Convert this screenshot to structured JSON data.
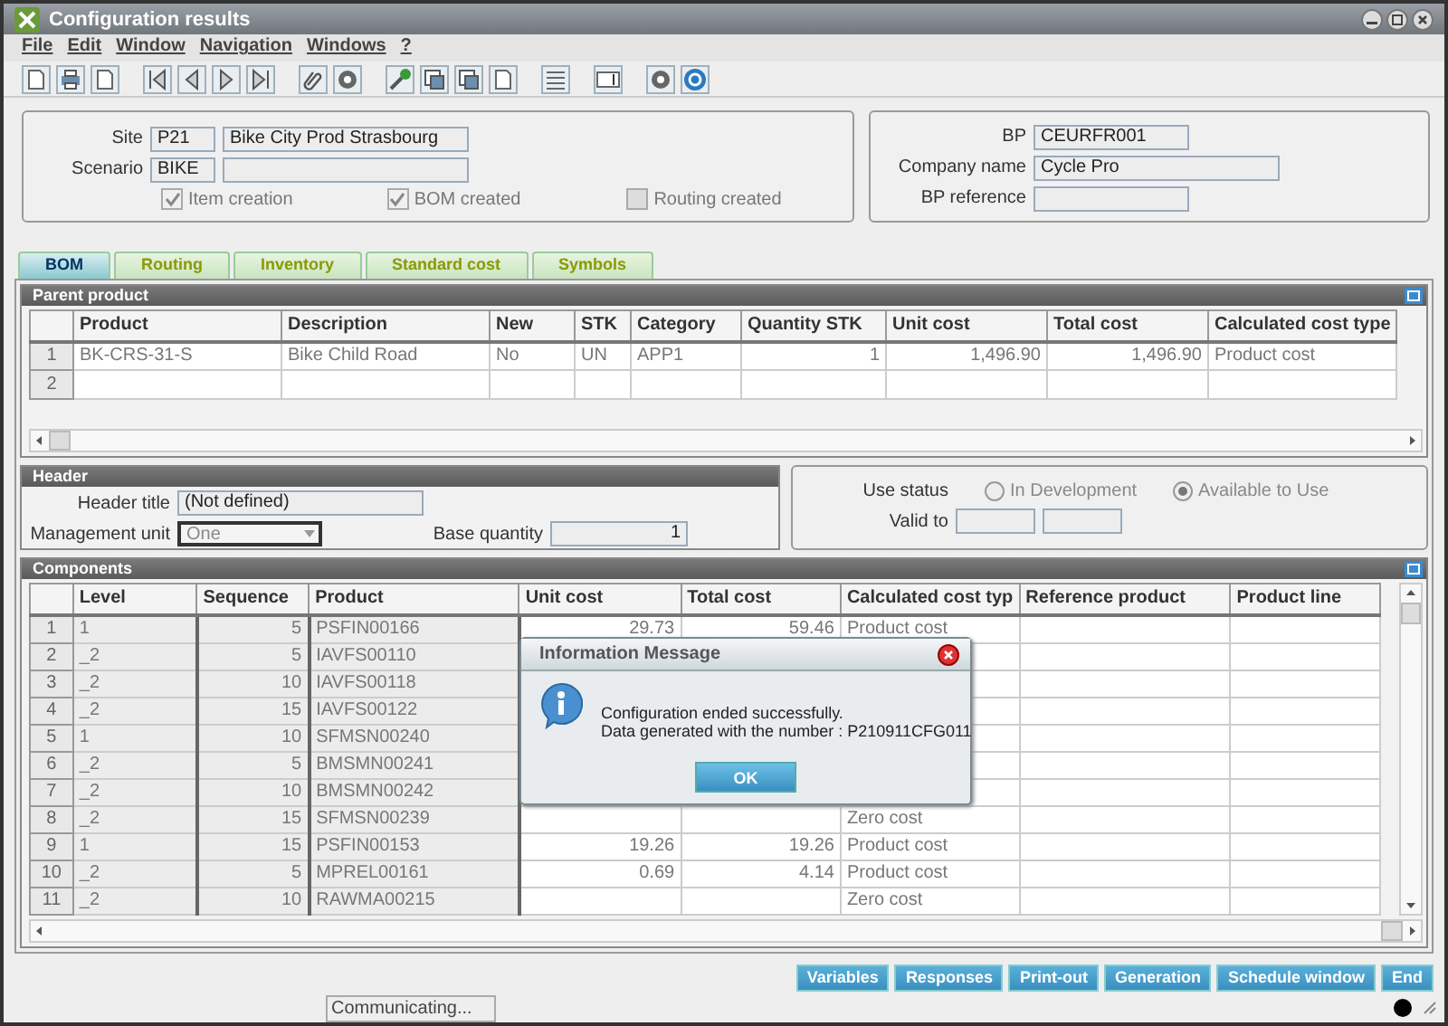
{
  "window": {
    "title": "Configuration results"
  },
  "menu": [
    "File",
    "Edit",
    "Window",
    "Navigation",
    "Windows",
    "?"
  ],
  "site": {
    "label": "Site",
    "code": "P21",
    "name": "Bike City Prod Strasbourg"
  },
  "scenario": {
    "label": "Scenario",
    "code": "BIKE"
  },
  "checkboxes": [
    {
      "label": "Item creation",
      "checked": true
    },
    {
      "label": "BOM created",
      "checked": true
    },
    {
      "label": "Routing created",
      "checked": false
    }
  ],
  "bp": [
    {
      "label": "BP",
      "value": "CEURFR001"
    },
    {
      "label": "Company name",
      "value": "Cycle Pro"
    },
    {
      "label": "BP reference"
    }
  ],
  "tabs": [
    {
      "label": "BOM",
      "selected": true
    },
    {
      "label": "Routing",
      "selected": false
    },
    {
      "label": "Inventory",
      "selected": false
    },
    {
      "label": "Standard cost",
      "selected": false
    },
    {
      "label": "Symbols",
      "selected": false
    }
  ],
  "parent_product": {
    "title": "Parent product",
    "columns": [
      "Product",
      "Description",
      "New",
      "STK",
      "Category",
      "Quantity STK",
      "Unit cost",
      "Total cost",
      "Calculated cost type"
    ],
    "rows": [
      {
        "num": "1",
        "product": "BK-CRS-31-S",
        "description": "Bike Child Road",
        "new": "No",
        "stk": "UN",
        "category": "APP1",
        "quantity_stk": "1",
        "unit_cost": "1,496.90",
        "total_cost": "1,496.90",
        "cost_type": "Product cost"
      },
      {
        "num": "2"
      }
    ]
  },
  "header": {
    "title": "Header",
    "header_title": {
      "label": "Header title",
      "value": "(Not defined)"
    },
    "management_unit": {
      "label": "Management unit",
      "value": "One"
    },
    "base_quantity": {
      "label": "Base quantity",
      "value": "1"
    },
    "use_status": {
      "label": "Use status",
      "options": [
        {
          "label": "In Development",
          "selected": false
        },
        {
          "label": "Available to Use",
          "selected": true
        }
      ]
    },
    "valid_to": {
      "label": "Valid to"
    }
  },
  "components": {
    "title": "Components",
    "columns": [
      "Level",
      "Sequence",
      "Product",
      "Unit cost",
      "Total cost",
      "Calculated cost typ",
      "Reference product",
      "Product line"
    ],
    "rows": [
      {
        "num": "1",
        "level": "1",
        "sequence": "5",
        "product": "PSFIN00166",
        "unit_cost": "29.73",
        "total_cost": "59.46",
        "cost_type": "Product cost"
      },
      {
        "num": "2",
        "level": "_2",
        "sequence": "5",
        "product": "IAVFS00110"
      },
      {
        "num": "3",
        "level": "_2",
        "sequence": "10",
        "product": "IAVFS00118"
      },
      {
        "num": "4",
        "level": "_2",
        "sequence": "15",
        "product": "IAVFS00122"
      },
      {
        "num": "5",
        "level": "1",
        "sequence": "10",
        "product": "SFMSN00240"
      },
      {
        "num": "6",
        "level": "_2",
        "sequence": "5",
        "product": "BMSMN00241"
      },
      {
        "num": "7",
        "level": "_2",
        "sequence": "10",
        "product": "BMSMN00242"
      },
      {
        "num": "8",
        "level": "_2",
        "sequence": "15",
        "product": "SFMSN00239",
        "cost_type": "Zero cost"
      },
      {
        "num": "9",
        "level": "1",
        "sequence": "15",
        "product": "PSFIN00153",
        "unit_cost": "19.26",
        "total_cost": "19.26",
        "cost_type": "Product cost"
      },
      {
        "num": "10",
        "level": "_2",
        "sequence": "5",
        "product": "MPREL00161",
        "unit_cost": "0.69",
        "total_cost": "4.14",
        "cost_type": "Product cost"
      },
      {
        "num": "11",
        "level": "_2",
        "sequence": "10",
        "product": "RAWMA00215",
        "cost_type": "Zero cost"
      }
    ]
  },
  "dialog": {
    "title": "Information Message",
    "lines": [
      "Configuration ended successfully.",
      "Data generated with the number : P210911CFG011"
    ],
    "button": "OK"
  },
  "buttons": [
    "Variables",
    "Responses",
    "Print-out",
    "Generation",
    "Schedule window",
    "End"
  ],
  "status_bar": {
    "text": "Communicating..."
  }
}
